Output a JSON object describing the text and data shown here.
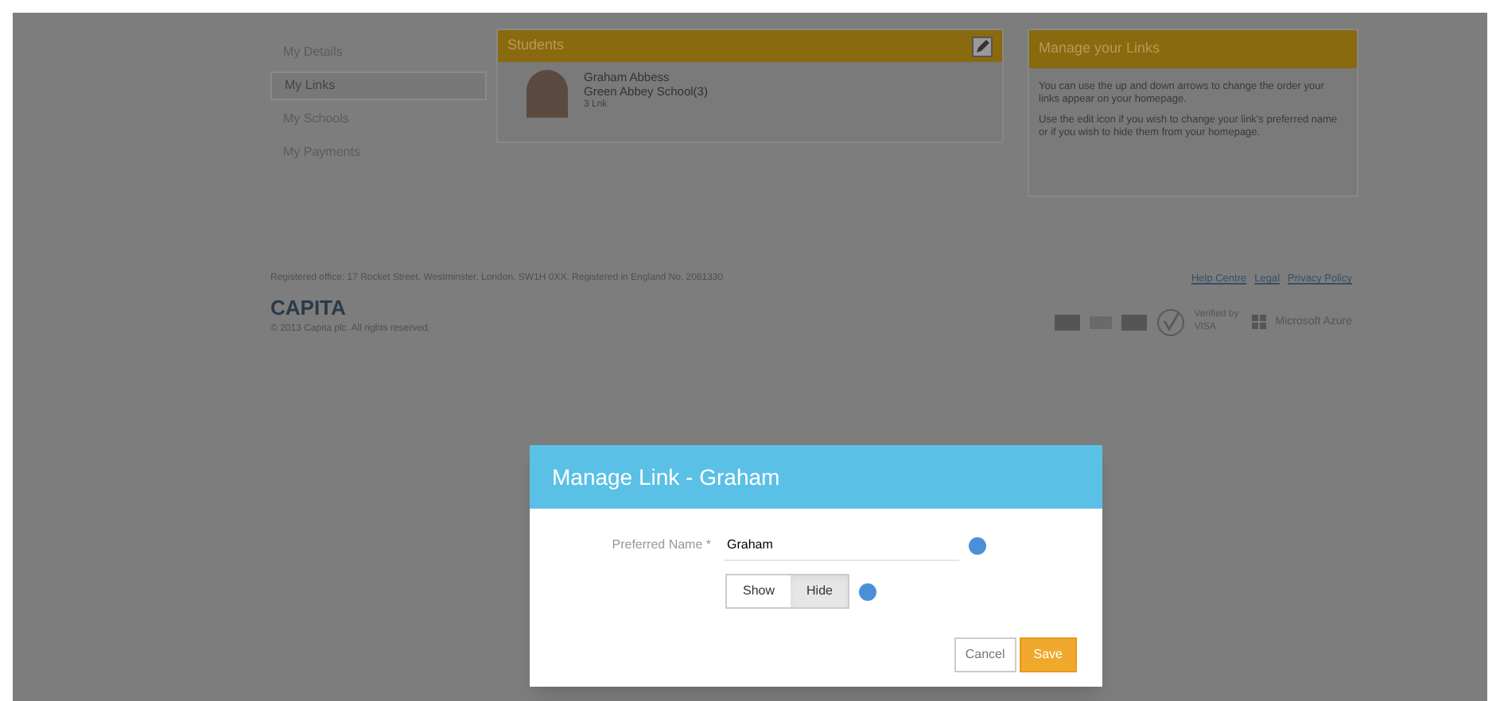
{
  "sidebar": {
    "items": [
      {
        "label": "My Details",
        "selected": false
      },
      {
        "label": "My Links",
        "selected": true
      },
      {
        "label": "My Schools",
        "selected": false
      },
      {
        "label": "My Payments",
        "selected": false
      }
    ]
  },
  "students_panel": {
    "title": "Students",
    "students": [
      {
        "name": "Graham Abbess",
        "school": "Green Abbey School(3)",
        "detail": "3 Lnk"
      }
    ]
  },
  "info_panel": {
    "title": "Manage your Links",
    "paragraphs": [
      "You can use the up and down arrows to change the order your links appear on your homepage.",
      "Use the edit icon if you wish to change your link's preferred name or if you wish to hide them from your homepage."
    ]
  },
  "footer": {
    "registered": "Registered office: 17 Rocket Street, Westminster, London, SW1H 0XX. Registered in England No. 2081330",
    "links": [
      "Help Centre",
      "Legal",
      "Privacy Policy"
    ],
    "brand": "CAPITA",
    "copyright": "© 2013 Capita plc. All rights reserved.",
    "badges": [
      "Verified by VISA",
      "Microsoft Azure"
    ]
  },
  "dialog": {
    "title": "Manage Link - Graham",
    "field_label": "Preferred Name *",
    "field_value": "Graham",
    "toggle": [
      {
        "label": "Show",
        "selected": false
      },
      {
        "label": "Hide",
        "selected": true
      }
    ],
    "buttons": [
      {
        "label": "Cancel",
        "kind": "secondary"
      },
      {
        "label": "Save",
        "kind": "primary"
      }
    ]
  }
}
